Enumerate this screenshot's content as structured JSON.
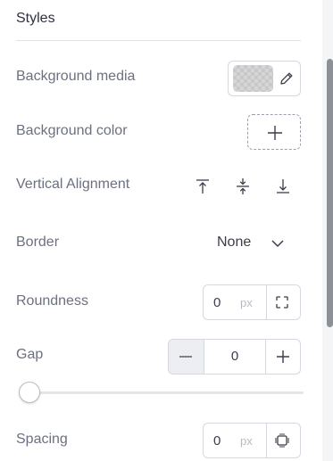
{
  "section": {
    "title": "Styles"
  },
  "background_media": {
    "label": "Background media",
    "edit_icon": "pencil-icon"
  },
  "background_color": {
    "label": "Background color",
    "add_icon": "plus-icon"
  },
  "vertical_alignment": {
    "label": "Vertical Alignment",
    "options": [
      "align-top-icon",
      "align-center-icon",
      "align-bottom-icon"
    ]
  },
  "border": {
    "label": "Border",
    "value": "None",
    "icon": "chevron-down-icon"
  },
  "roundness": {
    "label": "Roundness",
    "value": "0",
    "unit": "px",
    "icon": "corners-icon"
  },
  "gap": {
    "label": "Gap",
    "value": "0",
    "slider_fraction": 0
  },
  "spacing": {
    "label": "Spacing",
    "value": "0",
    "unit": "px",
    "icon": "padding-icon"
  },
  "colors": {
    "text": "#3c3c4a",
    "label": "#6c7080",
    "border": "#d5d8de",
    "scroll_thumb": "#8d9096"
  }
}
